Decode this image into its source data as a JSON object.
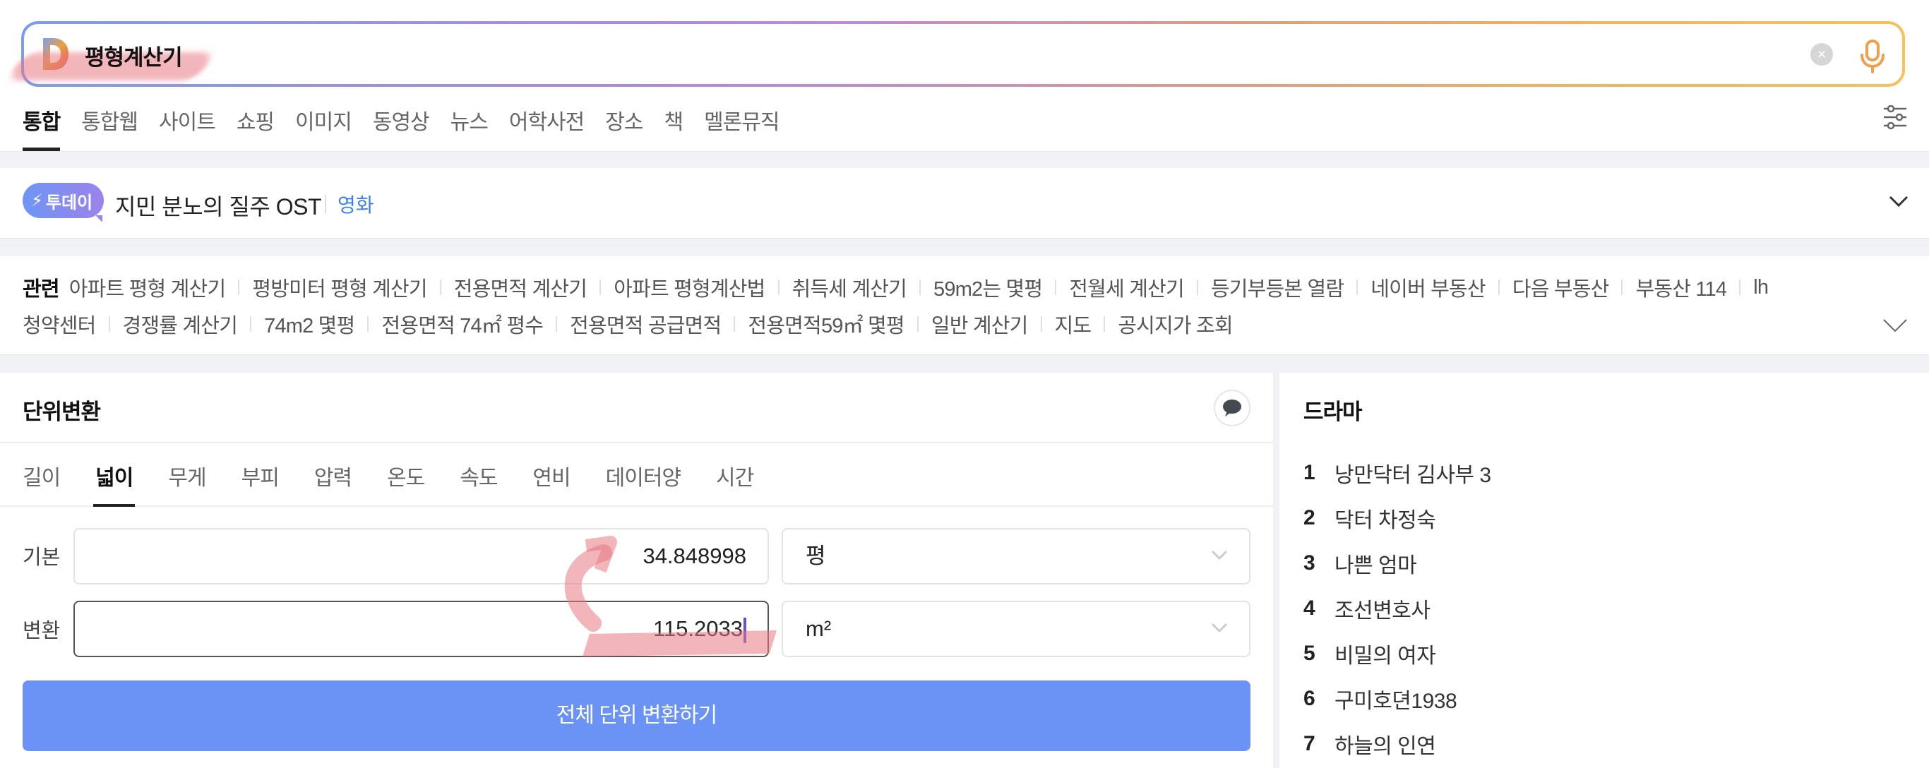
{
  "search": {
    "query": "평형계산기",
    "logo_icon": "daum-d-logo",
    "clear_icon": "clear-icon",
    "mic_icon": "microphone-icon"
  },
  "tabs": [
    {
      "label": "통합",
      "active": true
    },
    {
      "label": "통합웹"
    },
    {
      "label": "사이트"
    },
    {
      "label": "쇼핑"
    },
    {
      "label": "이미지"
    },
    {
      "label": "동영상"
    },
    {
      "label": "뉴스"
    },
    {
      "label": "어학사전"
    },
    {
      "label": "장소"
    },
    {
      "label": "책"
    },
    {
      "label": "멜론뮤직"
    }
  ],
  "today": {
    "badge": "투데이",
    "title": "지민 분노의 질주 OST",
    "category": "영화"
  },
  "related": {
    "label": "관련",
    "line1": [
      "아파트 평형 계산기",
      "평방미터 평형 계산기",
      "전용면적 계산기",
      "아파트 평형계산법",
      "취득세 계산기",
      "59m2는 몇평",
      "전월세 계산기",
      "등기부등본 열람",
      "네이버 부동산",
      "다음 부동산",
      "부동산 114",
      "lh"
    ],
    "line2": [
      "청약센터",
      "경쟁률 계산기",
      "74m2 몇평",
      "전용면적 74㎡ 평수",
      "전용면적 공급면적",
      "전용면적59㎡ 몇평",
      "일반 계산기",
      "지도",
      "공시지가 조회"
    ]
  },
  "converter": {
    "title": "단위변환",
    "unit_tabs": [
      {
        "label": "길이"
      },
      {
        "label": "넓이",
        "active": true
      },
      {
        "label": "무게"
      },
      {
        "label": "부피"
      },
      {
        "label": "압력"
      },
      {
        "label": "온도"
      },
      {
        "label": "속도"
      },
      {
        "label": "연비"
      },
      {
        "label": "데이터양"
      },
      {
        "label": "시간"
      }
    ],
    "base_label": "기본",
    "base_value": "34.848998",
    "base_unit": "평",
    "result_label": "변환",
    "result_value": "115.2033",
    "result_unit": "m²",
    "convert_all_button": "전체 단위 변환하기",
    "accent_color": "#6b93f6"
  },
  "drama": {
    "title": "드라마",
    "items": [
      {
        "rank": "1",
        "title": "낭만닥터 김사부 3"
      },
      {
        "rank": "2",
        "title": "닥터 차정숙"
      },
      {
        "rank": "3",
        "title": "나쁜 엄마"
      },
      {
        "rank": "4",
        "title": "조선변호사"
      },
      {
        "rank": "5",
        "title": "비밀의 여자"
      },
      {
        "rank": "6",
        "title": "구미호뎐1938"
      },
      {
        "rank": "7",
        "title": "하늘의 인연"
      }
    ]
  }
}
